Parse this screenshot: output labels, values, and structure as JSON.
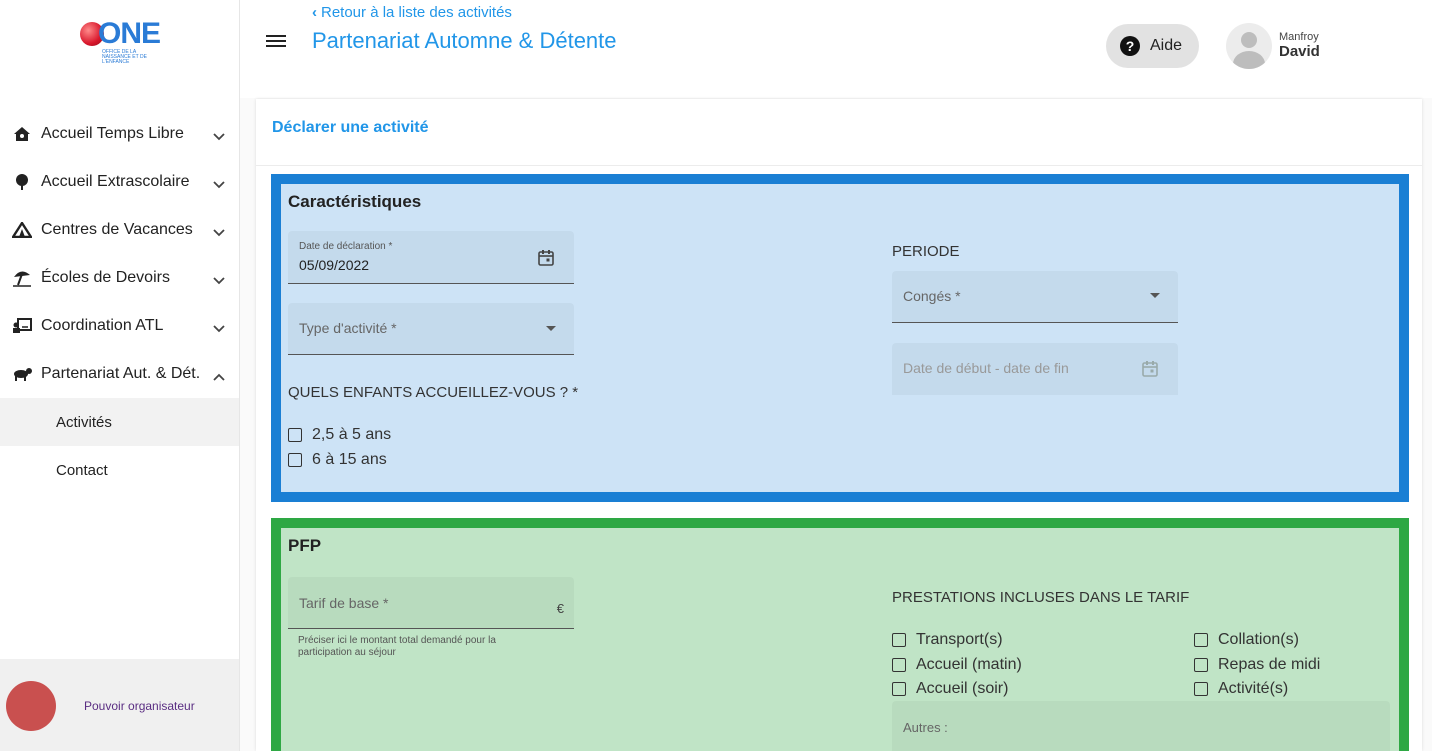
{
  "app": {
    "logo_text": "ONE",
    "logo_subtitle": "Office de la naissance et de l'enfance"
  },
  "sidebar": {
    "items": [
      {
        "label": "Accueil Temps Libre",
        "icon": "house-icon"
      },
      {
        "label": "Accueil Extrascolaire",
        "icon": "tree-icon"
      },
      {
        "label": "Centres de Vacances",
        "icon": "tent-icon"
      },
      {
        "label": "Écoles de Devoirs",
        "icon": "beach-umbrella-icon"
      },
      {
        "label": "Coordination ATL",
        "icon": "presenter-icon"
      },
      {
        "label": "Partenariat Aut. & Dét.",
        "icon": "animal-icon"
      }
    ],
    "subitems": [
      {
        "label": "Activités",
        "active": true
      },
      {
        "label": "Contact",
        "active": false
      }
    ],
    "organizer_label": "Pouvoir organisateur"
  },
  "header": {
    "back_link": "Retour à la liste des activités",
    "title": "Partenariat Automne & Détente",
    "help_label": "Aide",
    "user_first_name": "Manfroy",
    "user_last_name": "David"
  },
  "card": {
    "title": "Déclarer une activité"
  },
  "caracteristiques": {
    "title": "Caractéristiques",
    "declaration_date_label": "Date de déclaration *",
    "declaration_date_value": "05/09/2022",
    "activity_type_placeholder": "Type d'activité *",
    "children_question": "QUELS ENFANTS ACCUEILLEZ-VOUS ? *",
    "age_options": [
      "2,5 à 5 ans",
      "6 à 15 ans"
    ],
    "period_label": "PERIODE",
    "conges_placeholder": "Congés *",
    "date_range_placeholder": "Date de début - date de fin"
  },
  "pfp": {
    "title": "PFP",
    "tarif_placeholder": "Tarif de base *",
    "currency": "€",
    "tarif_hint": "Préciser ici le montant total demandé pour la participation au séjour",
    "prestations_label": "PRESTATIONS INCLUSES DANS LE TARIF",
    "prestations_left": [
      "Transport(s)",
      "Accueil (matin)",
      "Accueil (soir)"
    ],
    "prestations_right": [
      "Collation(s)",
      "Repas de midi",
      "Activité(s)"
    ],
    "autres_placeholder": "Autres :"
  },
  "colors": {
    "accent": "#2196e8",
    "section1_border": "#1a7fd4",
    "section1_bg": "#cde3f6",
    "section2_border": "#2ea844",
    "section2_bg": "#c0e4c6",
    "organizer_avatar": "#c9504f"
  }
}
